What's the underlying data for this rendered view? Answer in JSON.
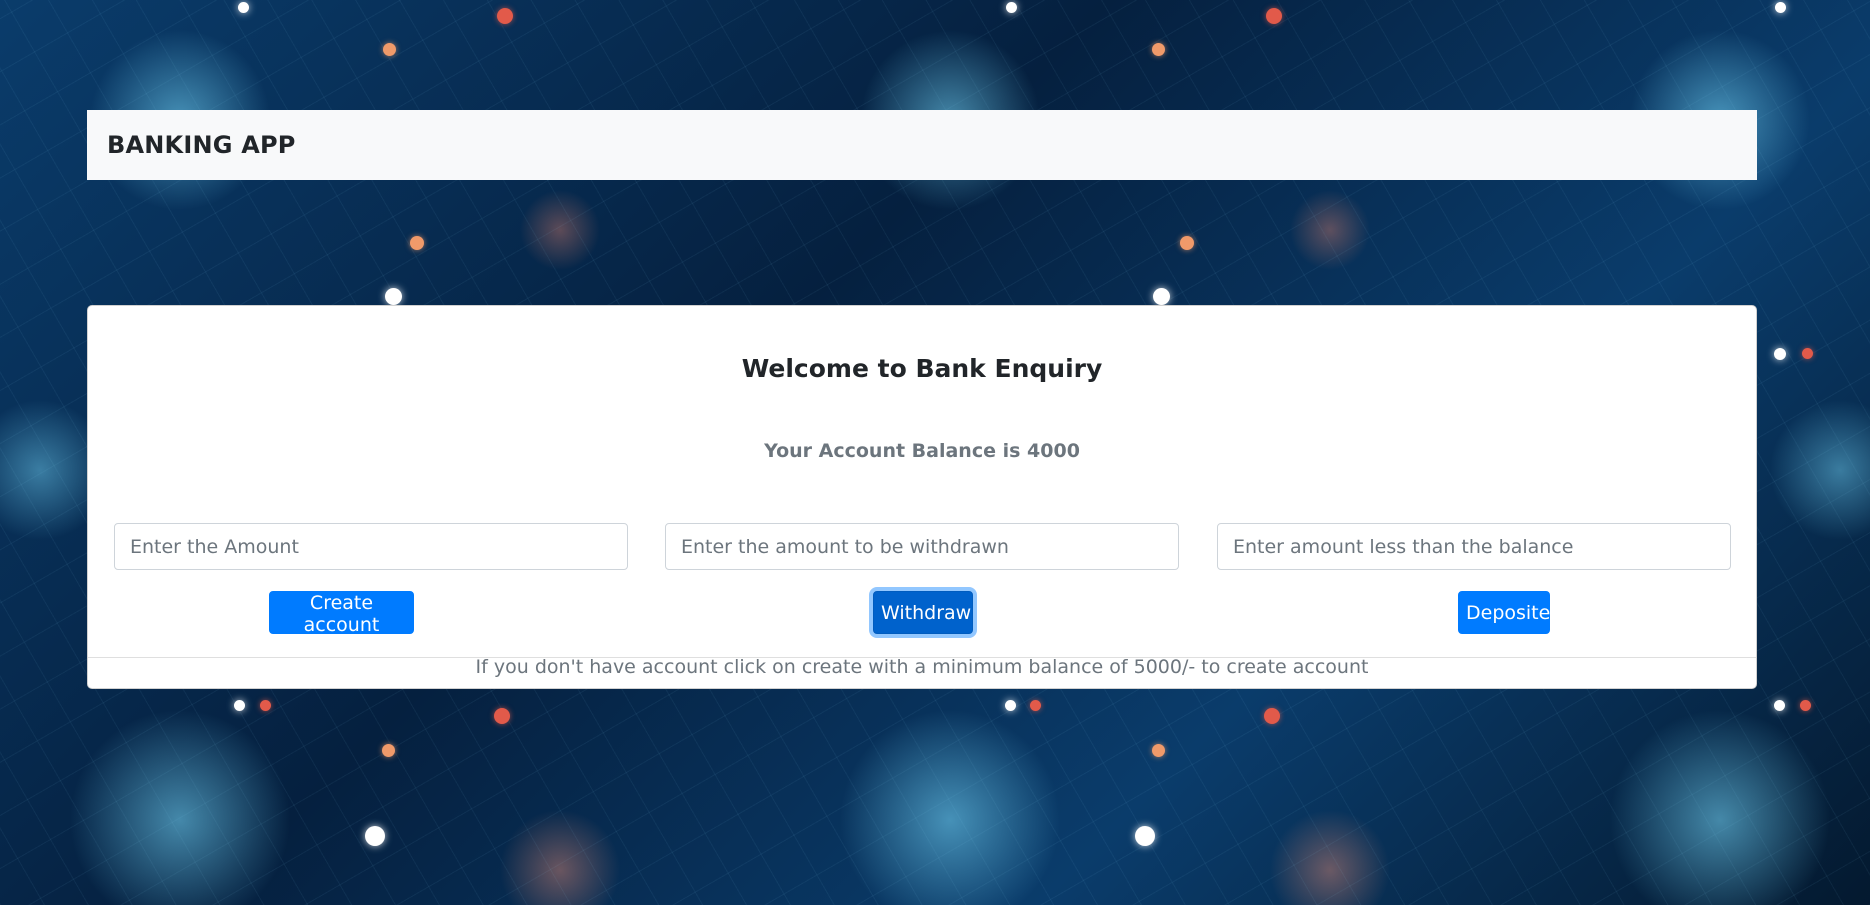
{
  "navbar": {
    "brand": "BANKING APP"
  },
  "card": {
    "title": "Welcome to Bank Enquiry",
    "balance_text": "Your Account Balance is 4000",
    "inputs": [
      {
        "placeholder": "Enter the Amount",
        "value": ""
      },
      {
        "placeholder": "Enter the amount to be withdrawn",
        "value": ""
      },
      {
        "placeholder": "Enter amount less than the balance",
        "value": ""
      }
    ],
    "buttons": {
      "create": "Create account",
      "withdraw": "Withdraw",
      "deposite": "Deposite"
    },
    "footer": "If you don't have account click on create with a minimum balance of 5000/- to create account"
  },
  "colors": {
    "primary": "#007bff",
    "primary_active": "#0062cc",
    "navbar_bg": "#f8f9fa",
    "muted_text": "#6c757d"
  }
}
